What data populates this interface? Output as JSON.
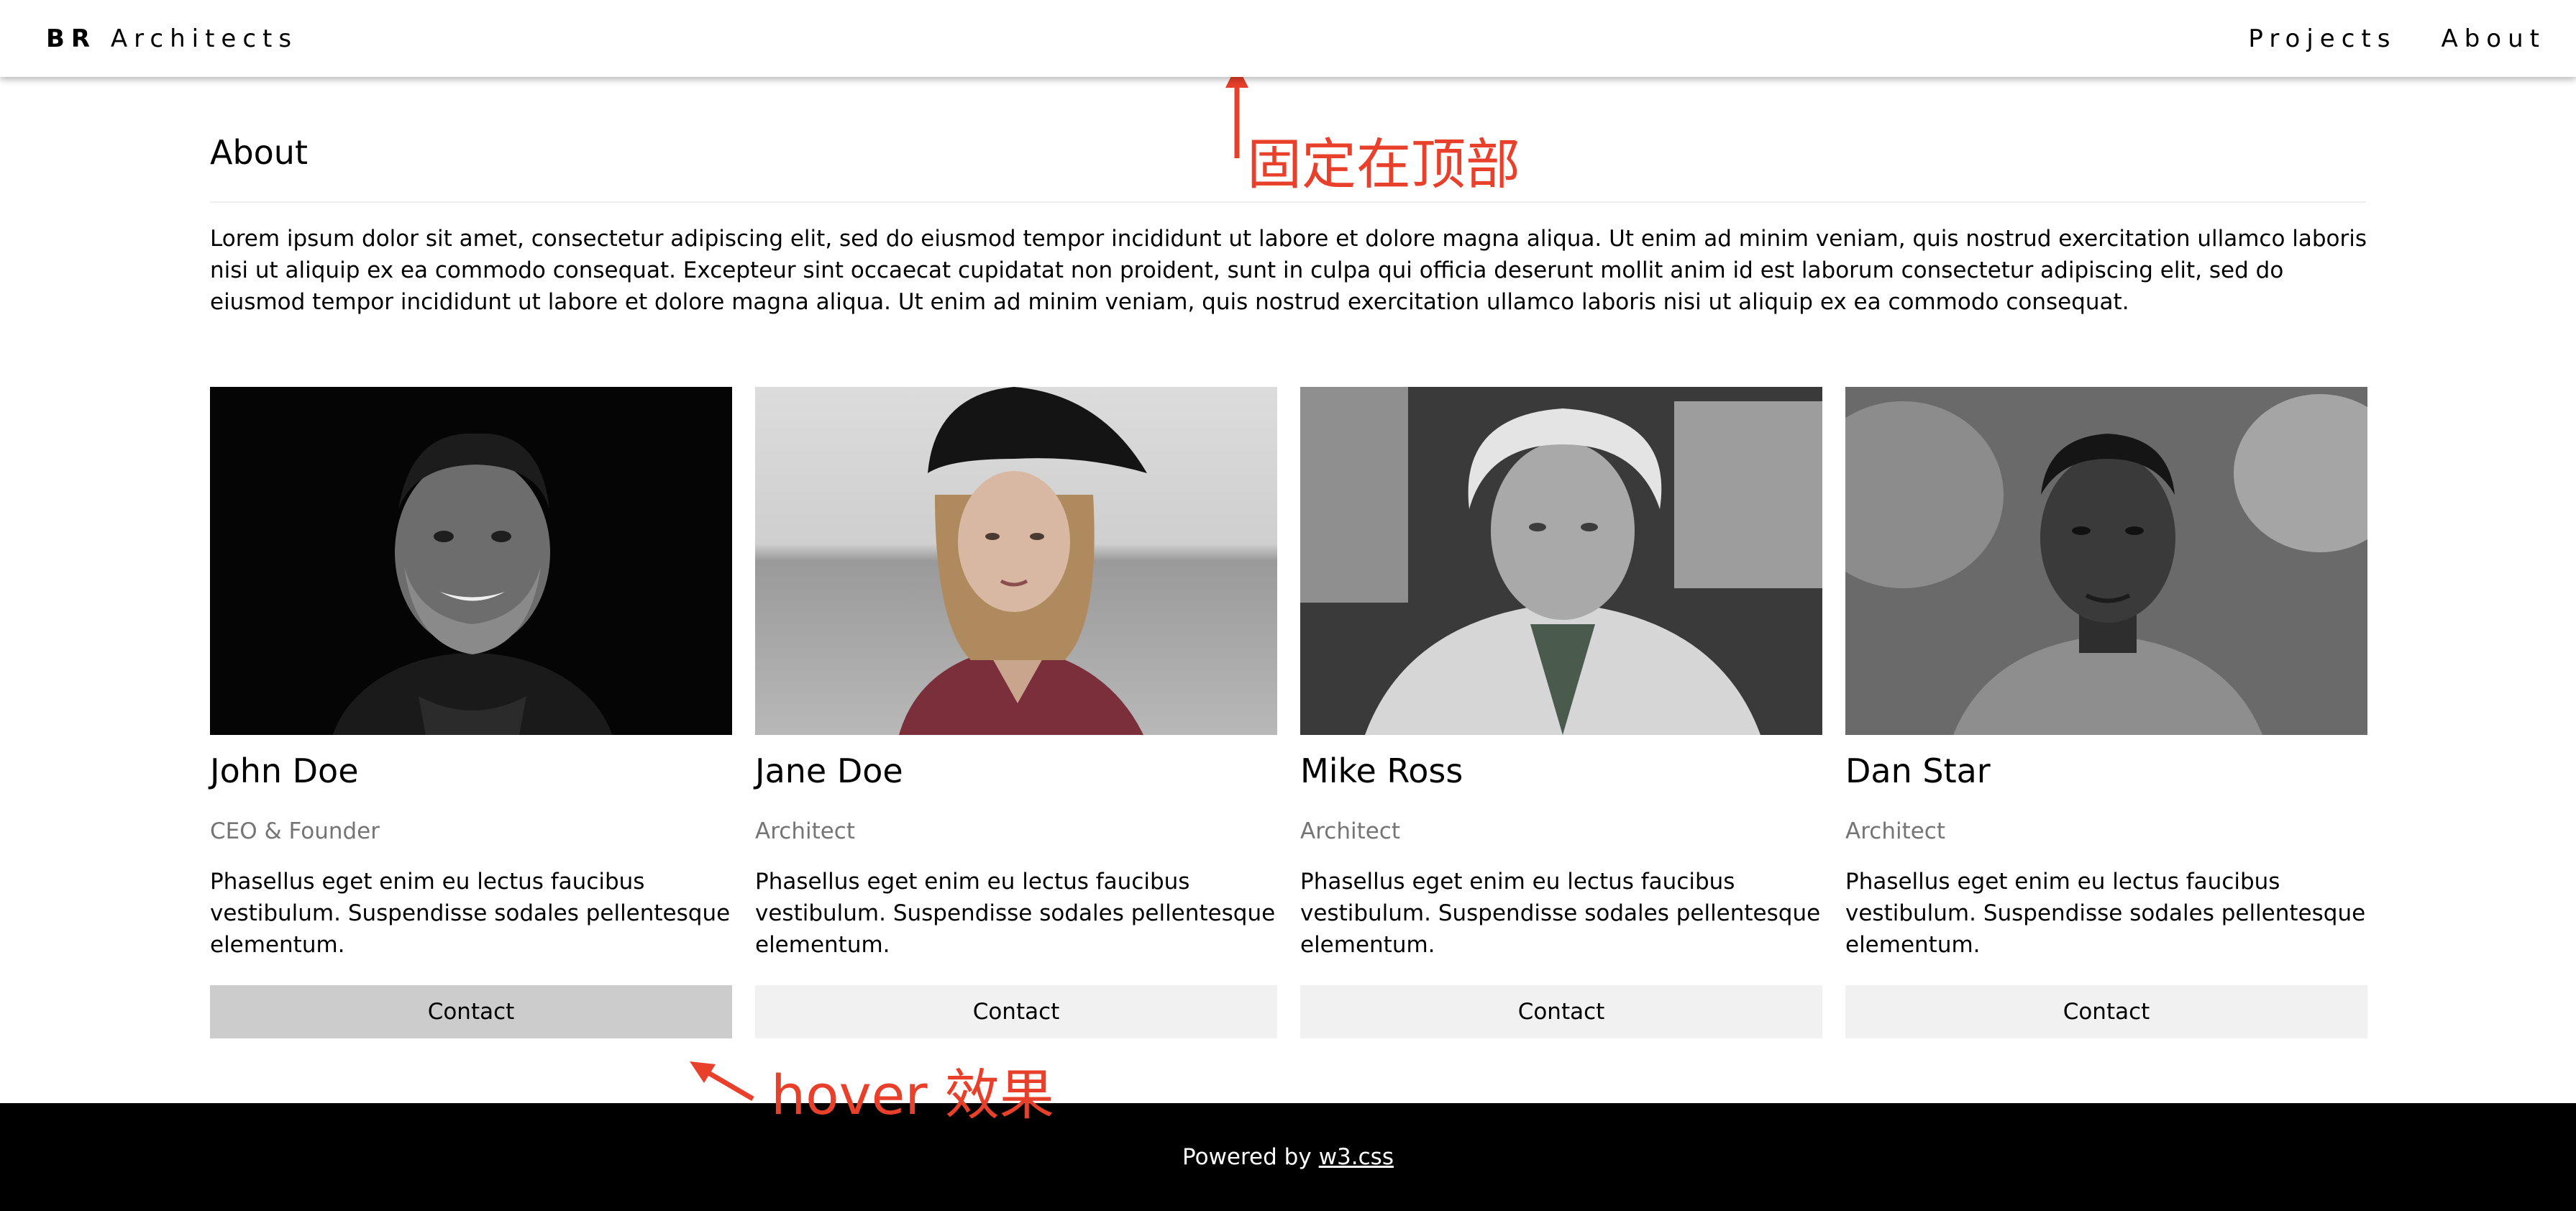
{
  "nav": {
    "brand_bold": "BR",
    "brand_rest": "Architects",
    "links": [
      "Projects",
      "About"
    ]
  },
  "about": {
    "title": "About",
    "text": "Lorem ipsum dolor sit amet, consectetur adipiscing elit, sed do eiusmod tempor incididunt ut labore et dolore magna aliqua. Ut enim ad minim veniam, quis nostrud exercitation ullamco laboris nisi ut aliquip ex ea commodo consequat. Excepteur sint occaecat cupidatat non proident, sunt in culpa qui officia deserunt mollit anim id est laborum consectetur adipiscing elit, sed do eiusmod tempor incididunt ut labore et dolore magna aliqua. Ut enim ad minim veniam, quis nostrud exercitation ullamco laboris nisi ut aliquip ex ea commodo consequat."
  },
  "team": [
    {
      "name": "John Doe",
      "role": "CEO & Founder",
      "bio": "Phasellus eget enim eu lectus faucibus vestibulum. Suspendisse sodales pellentesque elementum.",
      "button": "Contact"
    },
    {
      "name": "Jane Doe",
      "role": "Architect",
      "bio": "Phasellus eget enim eu lectus faucibus vestibulum. Suspendisse sodales pellentesque elementum.",
      "button": "Contact"
    },
    {
      "name": "Mike Ross",
      "role": "Architect",
      "bio": "Phasellus eget enim eu lectus faucibus vestibulum. Suspendisse sodales pellentesque elementum.",
      "button": "Contact"
    },
    {
      "name": "Dan Star",
      "role": "Architect",
      "bio": "Phasellus eget enim eu lectus faucibus vestibulum. Suspendisse sodales pellentesque elementum.",
      "button": "Contact"
    }
  ],
  "footer": {
    "prefix": "Powered by",
    "link": "w3.css"
  },
  "annotations": {
    "top": "固定在顶部",
    "hover": "hover 效果"
  },
  "colors": {
    "annotation": "#e8402a",
    "button": "#f1f1f1",
    "button_hover": "#cccccc",
    "footer": "#000000"
  }
}
